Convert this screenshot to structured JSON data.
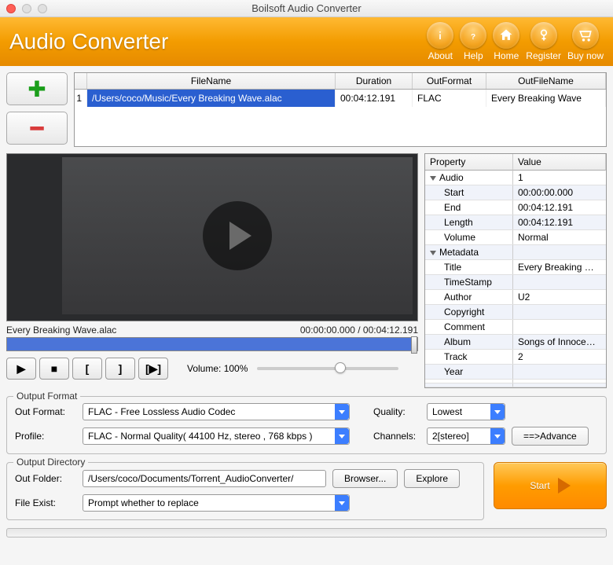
{
  "window": {
    "title": "Boilsoft Audio Converter"
  },
  "header": {
    "app_name": "Audio Converter",
    "buttons": {
      "about": "About",
      "help": "Help",
      "home": "Home",
      "register": "Register",
      "buy": "Buy now"
    }
  },
  "filelist": {
    "headers": {
      "filename": "FileName",
      "duration": "Duration",
      "outformat": "OutFormat",
      "outfilename": "OutFileName"
    },
    "rows": [
      {
        "idx": "1",
        "filename": "/Users/coco/Music/Every Breaking Wave.alac",
        "duration": "00:04:12.191",
        "outformat": "FLAC",
        "outfilename": "Every Breaking Wave"
      }
    ]
  },
  "preview": {
    "filename": "Every Breaking Wave.alac",
    "time": "00:00:00.000 / 00:04:12.191",
    "volume_label": "Volume: 100%"
  },
  "properties": {
    "headers": {
      "prop": "Property",
      "val": "Value"
    },
    "audio_group": "Audio",
    "audio_val": "1",
    "start_k": "Start",
    "start_v": "00:00:00.000",
    "end_k": "End",
    "end_v": "00:04:12.191",
    "length_k": "Length",
    "length_v": "00:04:12.191",
    "volume_k": "Volume",
    "volume_v": "Normal",
    "meta_group": "Metadata",
    "title_k": "Title",
    "title_v": "Every Breaking …",
    "ts_k": "TimeStamp",
    "ts_v": "",
    "author_k": "Author",
    "author_v": "U2",
    "copy_k": "Copyright",
    "copy_v": "",
    "comm_k": "Comment",
    "comm_v": "",
    "album_k": "Album",
    "album_v": "Songs of Innoce…",
    "track_k": "Track",
    "track_v": "2",
    "year_k": "Year",
    "year_v": ""
  },
  "output_format": {
    "legend": "Output Format",
    "outformat_label": "Out Format:",
    "outformat_value": "FLAC - Free Lossless Audio Codec",
    "profile_label": "Profile:",
    "profile_value": "FLAC - Normal Quality( 44100 Hz, stereo , 768 kbps )",
    "quality_label": "Quality:",
    "quality_value": "Lowest",
    "channels_label": "Channels:",
    "channels_value": "2[stereo]",
    "advance_btn": "==>Advance"
  },
  "output_dir": {
    "legend": "Output Directory",
    "outfolder_label": "Out Folder:",
    "outfolder_value": "/Users/coco/Documents/Torrent_AudioConverter/",
    "browser_btn": "Browser...",
    "explore_btn": "Explore",
    "exist_label": "File Exist:",
    "exist_value": "Prompt whether to replace",
    "start_btn": "Start"
  },
  "transport": {
    "play": "▶",
    "stop": "■",
    "markin": "[",
    "markout": "]",
    "segment": "[▶]"
  }
}
